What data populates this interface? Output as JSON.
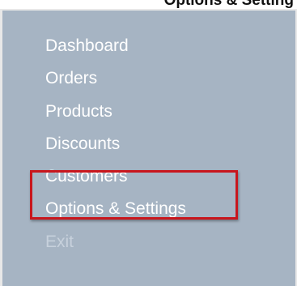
{
  "header": {
    "clipped_text": "Options & Setting"
  },
  "menu": {
    "items": [
      {
        "label": "Dashboard"
      },
      {
        "label": "Orders"
      },
      {
        "label": "Products"
      },
      {
        "label": "Discounts"
      },
      {
        "label": "Customers"
      },
      {
        "label": "Options & Settings"
      },
      {
        "label": "Exit"
      }
    ]
  },
  "colors": {
    "panel_background": "#a6b4c3",
    "menu_text": "#ffffff",
    "highlight_border": "#c8161d"
  }
}
